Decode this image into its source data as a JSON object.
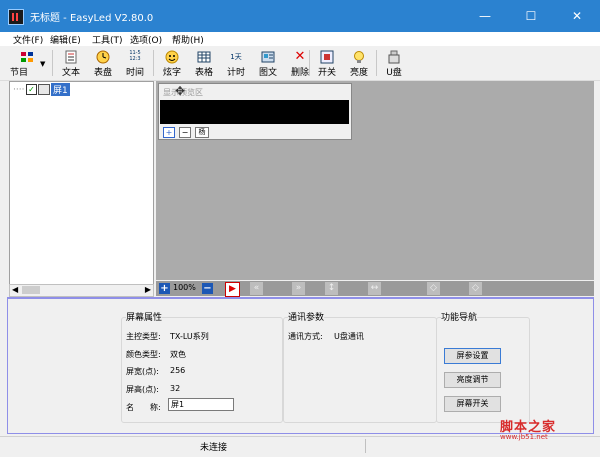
{
  "window": {
    "title": "无标题 - EasyLed V2.80.0",
    "minimize": "—",
    "maximize": "☐",
    "close": "✕"
  },
  "menu": [
    {
      "label": "文件(F)"
    },
    {
      "label": "编辑(E)"
    },
    {
      "label": "工具(T)"
    },
    {
      "label": "选项(O)"
    },
    {
      "label": "帮助(H)"
    }
  ],
  "toolbar": {
    "program": "节目",
    "text": "文本",
    "dial": "表盘",
    "time": "时间",
    "flashy": "炫字",
    "table": "表格",
    "timer": "计时",
    "image_text": "图文",
    "delete": "删除",
    "switch": "开关",
    "brightness": "亮度",
    "udisk": "U盘",
    "time_icon_text": "11-5\n12:3",
    "timer_icon_text": "1天"
  },
  "tree": {
    "screen_item": "屏1"
  },
  "screen_preview": {
    "title": "显示预览区",
    "plus": "+",
    "minus": "−",
    "mark": "杨"
  },
  "bottom_toolbar": {
    "zoom": "100%"
  },
  "properties": {
    "screen_section": "屏幕属性",
    "controller_label": "主控类型:",
    "controller_value": "TX-LU系列",
    "color_label": "颜色类型:",
    "color_value": "双色",
    "width_label": "屏宽(点):",
    "width_value": "256",
    "height_label": "屏高(点):",
    "height_value": "32",
    "name_label": "名　　称:",
    "name_value": "屏1"
  },
  "comm": {
    "section": "通讯参数",
    "mode_label": "通讯方式:",
    "mode_value": "U盘通讯"
  },
  "nav": {
    "section": "功能导航",
    "screen_params": "屏参设置",
    "brightness_adjust": "亮度调节",
    "screen_switch": "屏幕开关"
  },
  "status": {
    "connection": "未连接"
  },
  "watermark": {
    "text": "脚本之家",
    "url": "www.jb51.net"
  },
  "colors": {
    "titlebar": "#2b82d0",
    "canvas": "#ababab",
    "divider": "#8f8fe8",
    "screen": "#000000"
  }
}
